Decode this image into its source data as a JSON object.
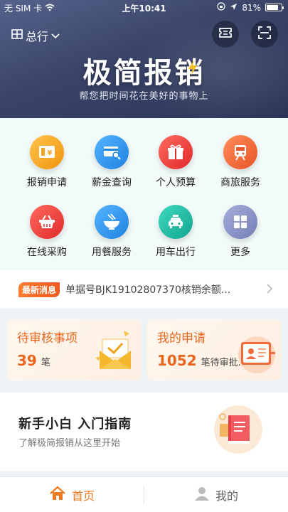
{
  "status_bar": {
    "carrier": "无 SIM 卡",
    "time": "上午10:41",
    "battery": "81%",
    "battery_level": 0.81
  },
  "header": {
    "branch": "总行",
    "logo": "极简报销",
    "slogan": "帮您把时间花在美好的事物上"
  },
  "menu": [
    {
      "label": "报销申请",
      "icon": "expense-form-icon",
      "color": "#f4a11c"
    },
    {
      "label": "薪金查询",
      "icon": "salary-search-icon",
      "color": "#2d9bf0"
    },
    {
      "label": "个人预算",
      "icon": "gift-budget-icon",
      "color": "#ee3b3b"
    },
    {
      "label": "商旅服务",
      "icon": "train-icon",
      "color": "#f26a3a"
    },
    {
      "label": "在线采购",
      "icon": "shopping-basket-icon",
      "color": "#ee3b3b"
    },
    {
      "label": "用餐服务",
      "icon": "bowl-icon",
      "color": "#2d9bf0"
    },
    {
      "label": "用车出行",
      "icon": "taxi-icon",
      "color": "#1fb9a3"
    },
    {
      "label": "更多",
      "icon": "more-grid-icon",
      "color": "#8a94c4"
    }
  ],
  "news": {
    "badge": "最新消息",
    "text": "单据号BJK19102807370核销余额..."
  },
  "cards": {
    "pending": {
      "title": "待审核事项",
      "count": "39",
      "unit": "笔"
    },
    "mine": {
      "title": "我的申请",
      "count": "1052",
      "unit": "笔待审批..."
    }
  },
  "guide": {
    "title": "新手小白 入门指南",
    "subtitle": "了解极简报销从这里开始"
  },
  "tabs": {
    "home": "首页",
    "mine": "我的"
  },
  "colors": {
    "accent": "#f0781e",
    "header_dark": "#2c3556"
  }
}
